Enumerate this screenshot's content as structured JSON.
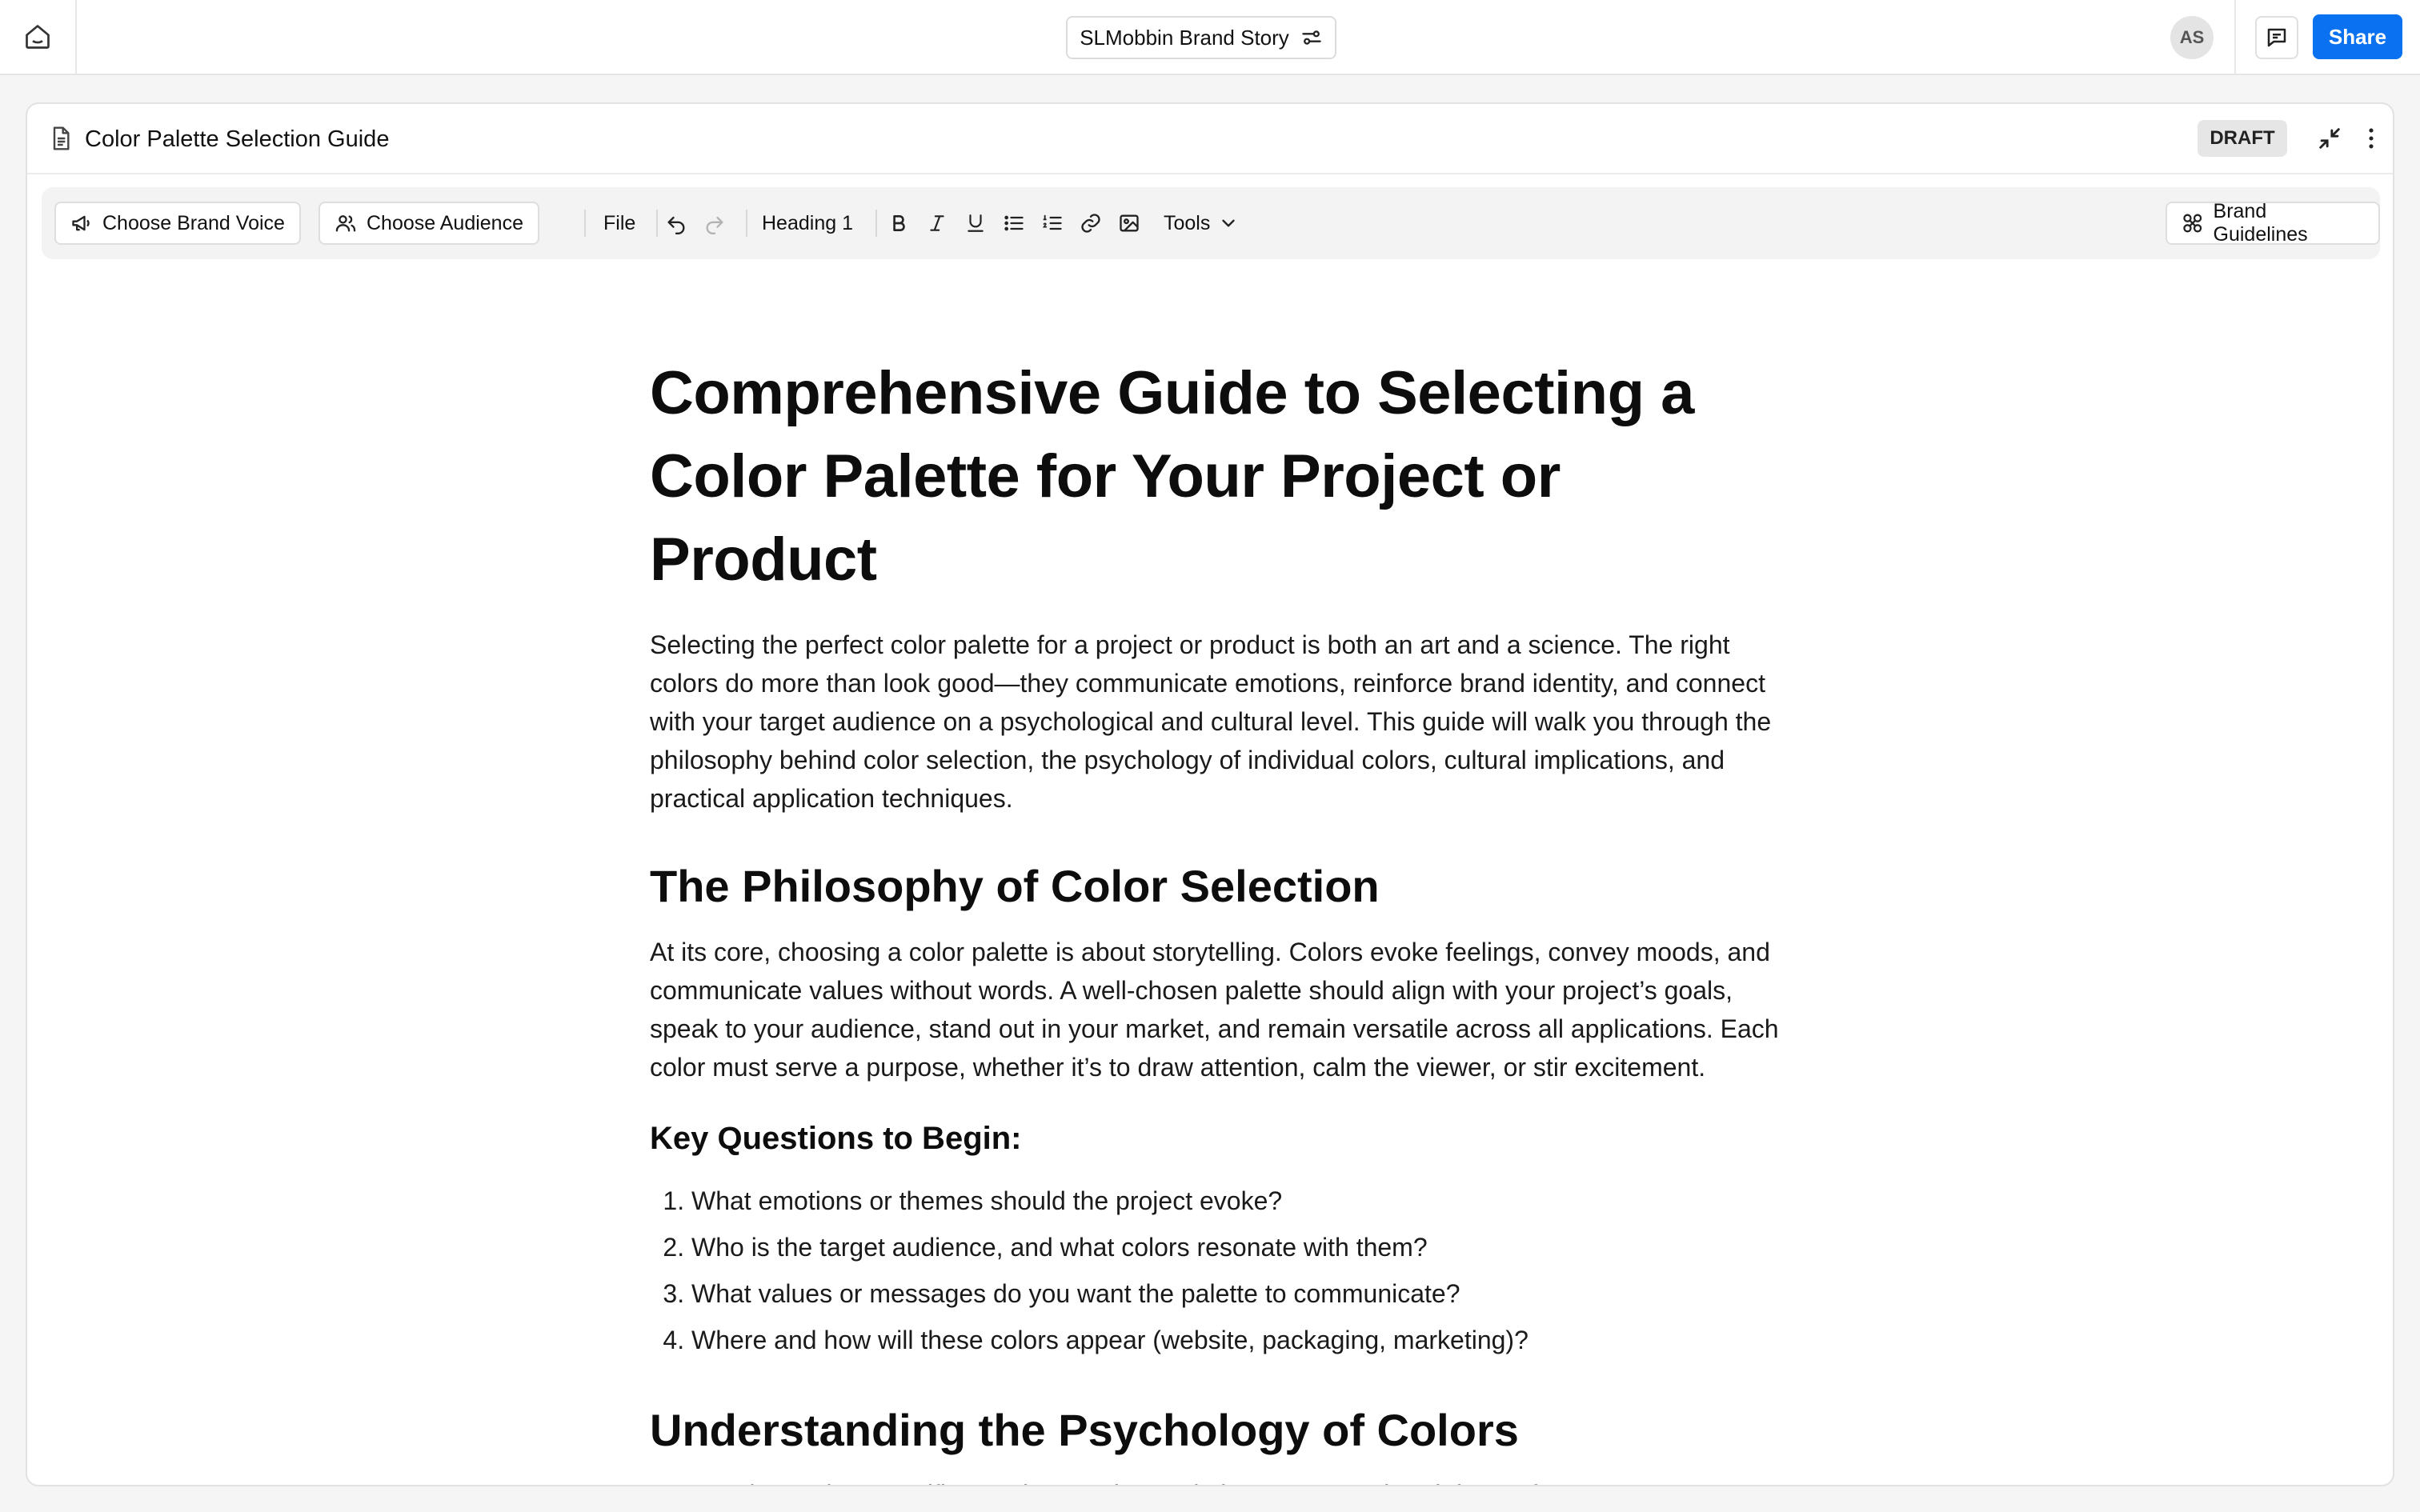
{
  "topbar": {
    "doc_switcher_label": "SLMobbin Brand Story",
    "avatar_initials": "AS",
    "share_label": "Share"
  },
  "doc": {
    "title": "Color Palette Selection Guide",
    "status": "DRAFT"
  },
  "toolbar": {
    "brand_voice": "Choose Brand Voice",
    "audience": "Choose Audience",
    "file": "File",
    "block_style": "Heading 1",
    "tools": "Tools",
    "brand_guidelines": "Brand Guidelines"
  },
  "content": {
    "title": "Comprehensive Guide to Selecting a Color Palette for Your Project or Product",
    "intro": "Selecting the perfect color palette for a project or product is both an art and a science. The right colors do more than look good—they communicate emotions, reinforce brand identity, and connect with your target audience on a psychological and cultural level. This guide will walk you through the philosophy behind color selection, the psychology of individual colors, cultural implications, and practical application techniques.",
    "section1_heading": "The Philosophy of Color Selection",
    "section1_para": "At its core, choosing a color palette is about storytelling. Colors evoke feelings, convey moods, and communicate values without words. A well-chosen palette should align with your project’s goals, speak to your audience, stand out in your market, and remain versatile across all applications. Each color must serve a purpose, whether it’s to draw attention, calm the viewer, or stir excitement.",
    "questions_heading": "Key Questions to Begin:",
    "questions": [
      "What emotions or themes should the project evoke?",
      "Who is the target audience, and what colors resonate with them?",
      "What values or messages do you want the palette to communicate?",
      "Where and how will these colors appear (website, packaging, marketing)?"
    ],
    "section2_heading": "Understanding the Psychology of Colors",
    "section2_para": "Every color evokes specific emotions and associations. Here’s a breakdown of common"
  },
  "colors": {
    "accent": "#0a72f0",
    "draft_badge": "#e6e6e6"
  }
}
